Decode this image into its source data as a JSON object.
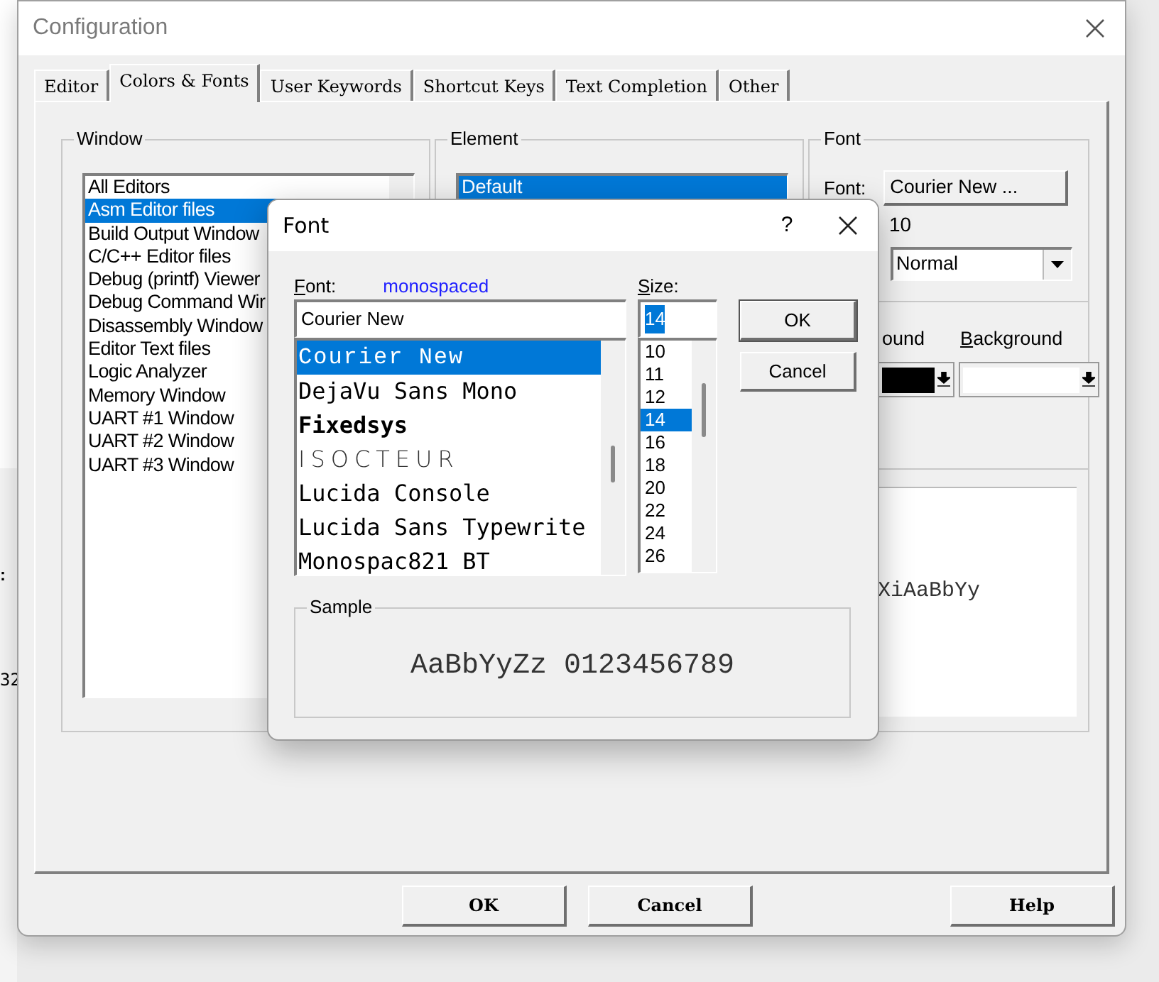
{
  "window": {
    "title": "Configuration"
  },
  "tabs": [
    {
      "label": "Editor",
      "selected": false
    },
    {
      "label": "Colors & Fonts",
      "selected": true
    },
    {
      "label": "User Keywords",
      "selected": false
    },
    {
      "label": "Shortcut Keys",
      "selected": false
    },
    {
      "label": "Text Completion",
      "selected": false
    },
    {
      "label": "Other",
      "selected": false
    }
  ],
  "window_group": {
    "title": "Window",
    "items": [
      {
        "label": "All Editors",
        "selected": false
      },
      {
        "label": "Asm Editor files",
        "selected": true
      },
      {
        "label": "Build Output Window",
        "selected": false
      },
      {
        "label": "C/C++ Editor files",
        "selected": false
      },
      {
        "label": "Debug (printf) Viewer",
        "selected": false
      },
      {
        "label": "Debug Command Wir",
        "selected": false
      },
      {
        "label": "Disassembly Window",
        "selected": false
      },
      {
        "label": "Editor Text files",
        "selected": false
      },
      {
        "label": "Logic Analyzer",
        "selected": false
      },
      {
        "label": "Memory Window",
        "selected": false
      },
      {
        "label": "UART #1 Window",
        "selected": false
      },
      {
        "label": "UART #2 Window",
        "selected": false
      },
      {
        "label": "UART #3 Window",
        "selected": false
      }
    ]
  },
  "element_group": {
    "title": "Element",
    "items": [
      {
        "label": "Default",
        "selected": true
      }
    ]
  },
  "font_group": {
    "title": "Font",
    "font_label": "Font:",
    "font_button": "Courier New ...",
    "size": "10",
    "style": "Normal",
    "colors": [
      {
        "label": "ound",
        "color": "#000000"
      },
      {
        "label": "Background",
        "color": "#ffffff"
      }
    ],
    "sample": "XiAaBbYy"
  },
  "buttons": [
    "OK",
    "Cancel",
    "Help"
  ],
  "background_fragments": [
    ":",
    "32"
  ],
  "font_dialog": {
    "title": "Font",
    "help": "?",
    "font_label": "Font:",
    "font_hint": "monospaced",
    "size_label": "Size:",
    "font_value": "Courier New",
    "size_value": "14",
    "fonts": [
      {
        "label": "Courier New",
        "selected": true,
        "kind": "courier"
      },
      {
        "label": "DejaVu Sans Mono",
        "selected": false,
        "kind": "mono"
      },
      {
        "label": "Fixedsys",
        "selected": false,
        "kind": "bold"
      },
      {
        "label": "ISOCTEUR",
        "selected": false,
        "kind": "spaced"
      },
      {
        "label": "Lucida Console",
        "selected": false,
        "kind": "mono"
      },
      {
        "label": "Lucida Sans Typewrite",
        "selected": false,
        "kind": "mono"
      },
      {
        "label": "Monospac821 BT",
        "selected": false,
        "kind": "mono"
      }
    ],
    "sizes": [
      {
        "label": "10",
        "selected": false
      },
      {
        "label": "11",
        "selected": false
      },
      {
        "label": "12",
        "selected": false
      },
      {
        "label": "14",
        "selected": true
      },
      {
        "label": "16",
        "selected": false
      },
      {
        "label": "18",
        "selected": false
      },
      {
        "label": "20",
        "selected": false
      },
      {
        "label": "22",
        "selected": false
      },
      {
        "label": "24",
        "selected": false
      },
      {
        "label": "26",
        "selected": false
      }
    ],
    "ok": "OK",
    "cancel": "Cancel",
    "sample_title": "Sample",
    "sample_text": "AaBbYyZz 0123456789"
  }
}
